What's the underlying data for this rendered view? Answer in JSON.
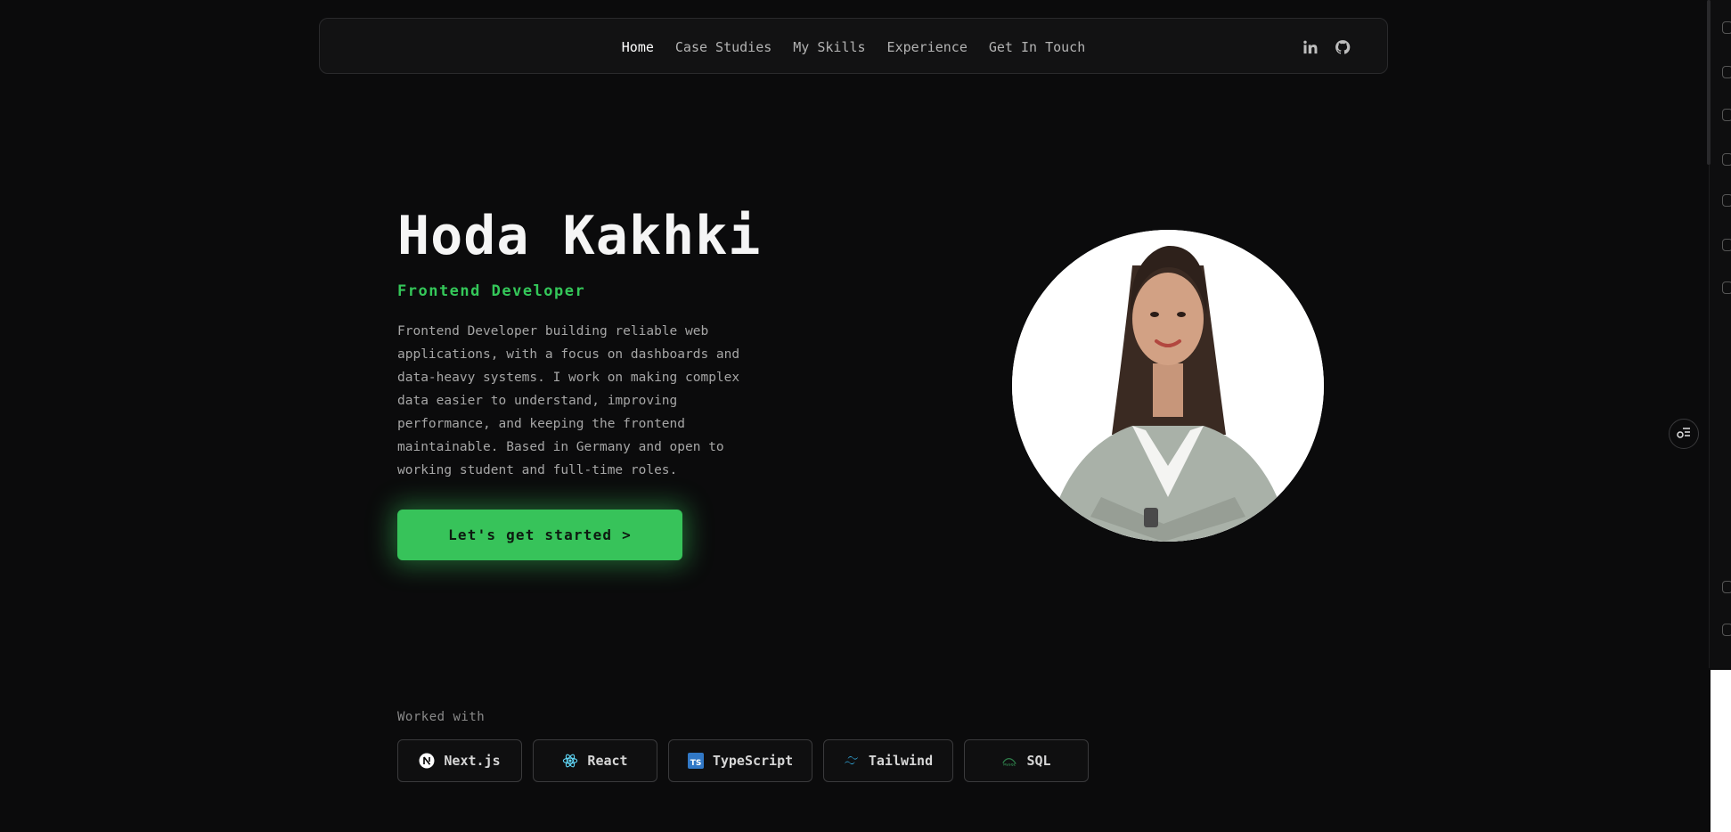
{
  "nav": {
    "links": [
      "Home",
      "Case Studies",
      "My Skills",
      "Experience",
      "Get In Touch"
    ],
    "active": "Home",
    "social": [
      "linkedin-icon",
      "github-icon"
    ]
  },
  "hero": {
    "name": "Hoda Kakhki",
    "role": "Frontend Developer",
    "bio": "Frontend Developer building reliable web applications, with a focus on dashboards and data-heavy systems. I work on making complex data easier to understand, improving performance, and keeping the frontend maintainable. Based in Germany and open to working student and full-time roles.",
    "cta_label": "Let's get started >"
  },
  "worked_with": {
    "label": "Worked with",
    "items": [
      {
        "label": "Next.js",
        "icon": "nextjs-icon"
      },
      {
        "label": "React",
        "icon": "react-icon"
      },
      {
        "label": "TypeScript",
        "icon": "typescript-icon"
      },
      {
        "label": "Tailwind",
        "icon": "tailwind-icon"
      },
      {
        "label": "SQL",
        "icon": "mysql-icon"
      }
    ]
  },
  "colors": {
    "background": "#0b0b0c",
    "accent": "#37c35a",
    "nav_bg": "#121213"
  }
}
